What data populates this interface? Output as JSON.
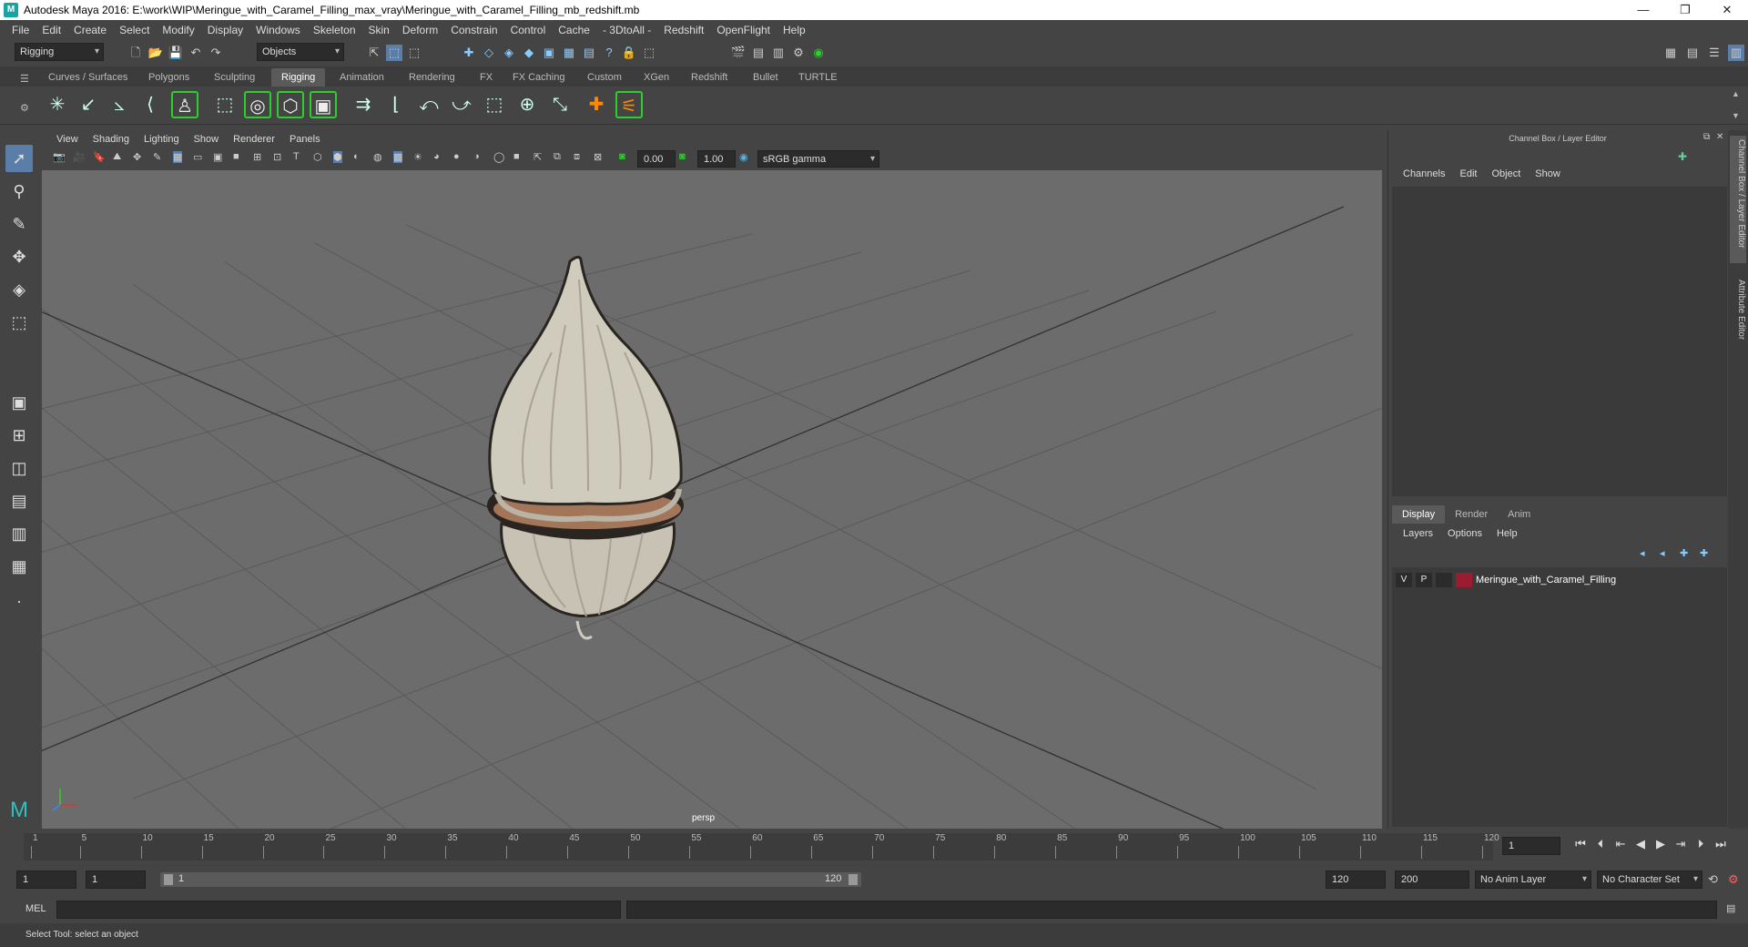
{
  "window": {
    "title": "Autodesk Maya 2016: E:\\work\\WIP\\Meringue_with_Caramel_Filling_max_vray\\Meringue_with_Caramel_Filling_mb_redshift.mb",
    "min": "—",
    "restore": "❐",
    "close": "✕"
  },
  "menus": [
    "File",
    "Edit",
    "Create",
    "Select",
    "Modify",
    "Display",
    "Windows",
    "Skeleton",
    "Skin",
    "Deform",
    "Constrain",
    "Control",
    "Cache",
    "- 3DtoAll -",
    "Redshift",
    "OpenFlight",
    "Help"
  ],
  "status_line": {
    "menuset": "Rigging",
    "selection_mode": "Objects"
  },
  "shelf_tabs": [
    "Curves / Surfaces",
    "Polygons",
    "Sculpting",
    "Rigging",
    "Animation",
    "Rendering",
    "FX",
    "FX Caching",
    "Custom",
    "XGen",
    "Redshift",
    "Bullet",
    "TURTLE"
  ],
  "active_shelf": "Rigging",
  "viewport": {
    "menus": [
      "View",
      "Shading",
      "Lighting",
      "Show",
      "Renderer",
      "Panels"
    ],
    "exposure": "0.00",
    "gamma": "1.00",
    "color_space": "sRGB gamma",
    "camera": "persp"
  },
  "channel_box": {
    "title": "Channel Box / Layer Editor",
    "menus": [
      "Channels",
      "Edit",
      "Object",
      "Show"
    ],
    "layer_tabs": [
      "Display",
      "Render",
      "Anim"
    ],
    "active_layer_tab": "Display",
    "layer_menus": [
      "Layers",
      "Options",
      "Help"
    ],
    "layers": [
      {
        "v": "V",
        "p": "P",
        "name": "Meringue_with_Caramel_Filling",
        "color": "#9b1b30"
      }
    ]
  },
  "side_tabs": [
    "Channel Box / Layer Editor",
    "Attribute Editor"
  ],
  "timeline": {
    "ticks": [
      "1",
      "5",
      "10",
      "15",
      "20",
      "25",
      "30",
      "35",
      "40",
      "45",
      "50",
      "55",
      "60",
      "65",
      "70",
      "75",
      "80",
      "85",
      "90",
      "95",
      "100",
      "105",
      "110",
      "115",
      "120"
    ],
    "current_frame": "1"
  },
  "range": {
    "start": "1",
    "playback_start": "1",
    "slider_start": "1",
    "slider_end": "120",
    "playback_end": "120",
    "end": "200",
    "anim_layer": "No Anim Layer",
    "character_set": "No Character Set"
  },
  "command": {
    "lang": "MEL"
  },
  "help_line": "Select Tool: select an object",
  "colors": {
    "accent": "#5a7ea8",
    "shelf_green": "#2ccf2c",
    "meringue": "#cfcbbd",
    "caramel": "#a3765a"
  }
}
